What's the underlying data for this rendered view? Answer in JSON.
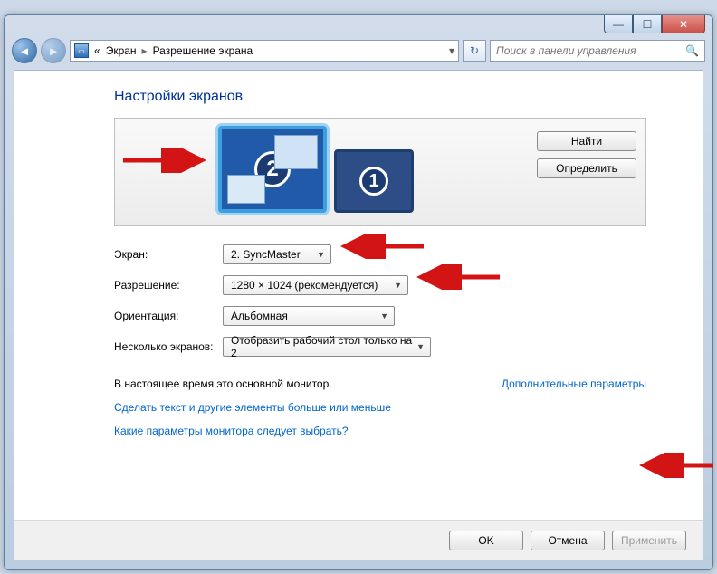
{
  "window_controls": {
    "min": "—",
    "max": "☐",
    "close": "✕"
  },
  "breadcrumb": {
    "prefix": "«",
    "item1": "Экран",
    "item2": "Разрешение экрана"
  },
  "refresh_icon": "↻",
  "search": {
    "placeholder": "Поиск в панели управления",
    "icon": "🔍"
  },
  "heading": "Настройки экранов",
  "monitors": {
    "m1": "1",
    "m2": "2"
  },
  "buttons": {
    "find": "Найти",
    "identify": "Определить",
    "ok": "OK",
    "cancel": "Отмена",
    "apply": "Применить"
  },
  "form": {
    "screen_label": "Экран:",
    "screen_value": "2. SyncMaster",
    "resolution_label": "Разрешение:",
    "resolution_value": "1280 × 1024 (рекомендуется)",
    "orientation_label": "Ориентация:",
    "orientation_value": "Альбомная",
    "multi_label": "Несколько экранов:",
    "multi_value": "Отобразить рабочий стол только на 2"
  },
  "note_text": "В настоящее время это основной монитор.",
  "adv_link": "Дополнительные параметры",
  "link1": "Сделать текст и другие элементы больше или меньше",
  "link2": "Какие параметры монитора следует выбрать?"
}
